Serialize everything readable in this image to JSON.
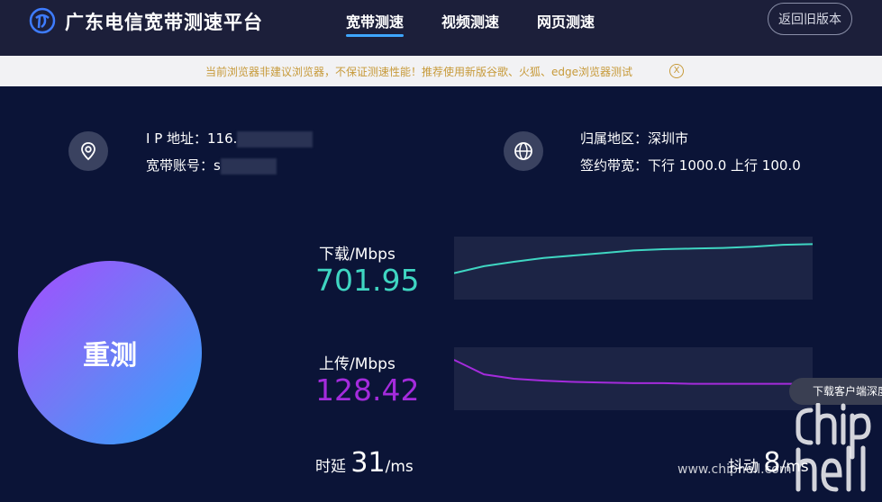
{
  "header": {
    "brand": "广东电信宽带测速平台",
    "tabs": [
      {
        "label": "宽带测速",
        "active": true
      },
      {
        "label": "视频测速",
        "active": false
      },
      {
        "label": "网页测速",
        "active": false
      }
    ],
    "back_label": "返回旧版本"
  },
  "notice": {
    "text": "当前浏览器非建议浏览器，不保证测速性能！推荐使用新版谷歌、火狐、edge浏览器测试",
    "close_label": "X"
  },
  "info": {
    "ip_label": "I P 地址：",
    "ip_value": "116.",
    "account_label": "宽带账号：",
    "account_value": "s",
    "region_label": "归属地区：",
    "region_value": "深圳市",
    "bandwidth_label": "签约带宽：",
    "bandwidth_value": "下行 1000.0 上行 100.0"
  },
  "retest_label": "重测",
  "download": {
    "label": "下载/Mbps",
    "value": "701.95",
    "color": "#3fd6c2",
    "series": [
      0.42,
      0.53,
      0.6,
      0.66,
      0.7,
      0.74,
      0.78,
      0.8,
      0.81,
      0.82,
      0.84,
      0.87,
      0.88
    ]
  },
  "upload": {
    "label": "上传/Mbps",
    "value": "128.42",
    "color": "#a42bdc",
    "series": [
      0.8,
      0.57,
      0.5,
      0.47,
      0.45,
      0.44,
      0.43,
      0.43,
      0.42,
      0.42,
      0.42,
      0.42,
      0.42
    ]
  },
  "latency": {
    "label": "时延",
    "value": "31",
    "unit": "/ms"
  },
  "jitter": {
    "label": "抖动",
    "value": "8",
    "unit": "/ms"
  },
  "float_button": "下载客户端深度",
  "watermark": {
    "url": "www.chiphell.com",
    "logo_text": "chip hell"
  }
}
